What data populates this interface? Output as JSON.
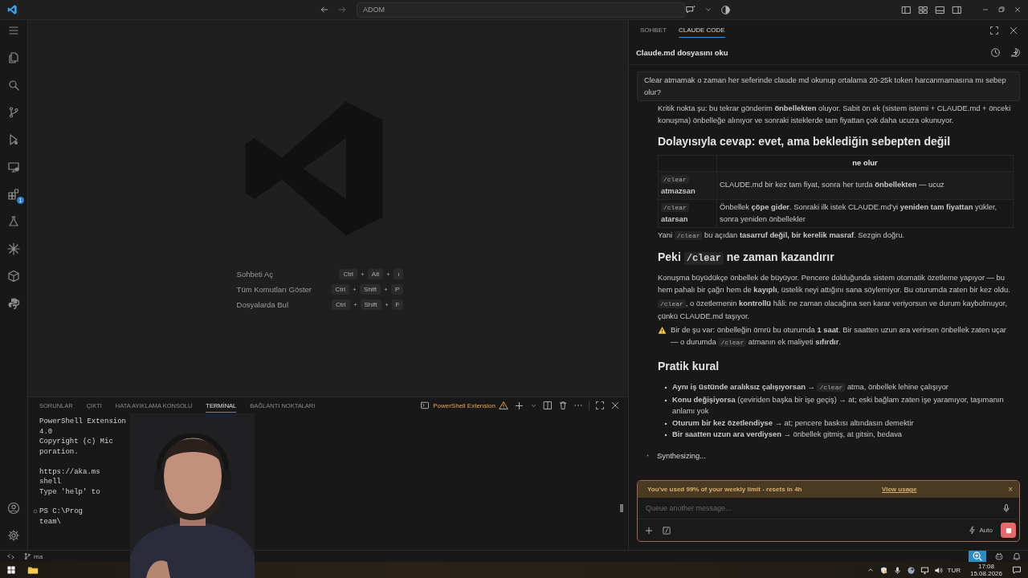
{
  "titlebar": {
    "search": "ADOM"
  },
  "activity_bar": {
    "extensions_badge": "1"
  },
  "shortcuts": [
    {
      "label": "Sohbeti Aç",
      "keys": [
        "Ctrl",
        "Alt",
        "ı"
      ]
    },
    {
      "label": "Tüm Komutları Göster",
      "keys": [
        "Ctrl",
        "Shift",
        "P"
      ]
    },
    {
      "label": "Dosyalarda Bul",
      "keys": [
        "Ctrl",
        "Shift",
        "F"
      ]
    }
  ],
  "panel": {
    "tabs": [
      {
        "label": "SORUNLAR",
        "selected": false
      },
      {
        "label": "ÇIKTI",
        "selected": false
      },
      {
        "label": "HATA AYIKLAMA KONSOLU",
        "selected": false
      },
      {
        "label": "TERMİNAL",
        "selected": true
      },
      {
        "label": "BAĞLANTI NOKTALARI",
        "selected": false
      }
    ],
    "terminal_name": "PowerShell Extension",
    "terminal_groups": [
      [
        "PowerShell Extension",
        "4.0",
        "Copyright (c) Mic",
        "poration."
      ],
      [
        "https://aka.ms",
        "shell",
        "Type 'help' to"
      ],
      [
        "PS C:\\Prog",
        "team\\"
      ]
    ]
  },
  "chat": {
    "tabs": [
      {
        "label": "SOHBET",
        "selected": false
      },
      {
        "label": "CLAUDE CODE",
        "selected": true
      }
    ],
    "title": "Claude.md dosyasını oku",
    "user_message": "Clear atmamak o zaman her seferinde claude md okunup ortalama 20-25k token harcanmamasına mı sebep olur?",
    "blocks": [
      {
        "kind": "paragraph",
        "segments": [
          {
            "kind": "text",
            "text": "Kritik nokta şu: bu tekrar gönderim **önbellekten** oluyor. Sabit ön ek (sistem istemi + CLAUDE.md + önceki konuşma) önbelleğe alınıyor ve sonraki isteklerde tam fiyattan çok daha ucuza okunuyor."
          }
        ]
      },
      {
        "kind": "heading",
        "segments": [
          {
            "kind": "text",
            "text": "Dolayısıyla cevap: evet, ama beklediğin sebepten değil"
          }
        ]
      },
      {
        "kind": "table",
        "header": "ne olur",
        "rows": [
          {
            "label": [
              {
                "kind": "code",
                "text": "/clear"
              },
              {
                "kind": "text",
                "text": " **atmazsan**"
              }
            ],
            "value": [
              {
                "kind": "text",
                "text": "CLAUDE.md bir kez tam fiyat, sonra her turda **önbellekten** — ucuz"
              }
            ]
          },
          {
            "label": [
              {
                "kind": "code",
                "text": "/clear"
              },
              {
                "kind": "text",
                "text": " **atarsan**"
              }
            ],
            "value": [
              {
                "kind": "text",
                "text": "Önbellek **çöpe gider**. Sonraki ilk istek CLAUDE.md'yi **yeniden tam fiyattan** yükler, sonra yeniden önbellekler"
              }
            ]
          }
        ]
      },
      {
        "kind": "paragraph",
        "segments": [
          {
            "kind": "text",
            "text": "Yani "
          },
          {
            "kind": "code",
            "text": "/clear"
          },
          {
            "kind": "text",
            "text": " bu açıdan **tasarruf değil, bir kerelik masraf**. Sezgin doğru."
          }
        ]
      },
      {
        "kind": "heading",
        "segments": [
          {
            "kind": "text",
            "text": "Peki "
          },
          {
            "kind": "code",
            "text": "/clear"
          },
          {
            "kind": "text",
            "text": " ne zaman kazandırır"
          }
        ]
      },
      {
        "kind": "paragraph",
        "segments": [
          {
            "kind": "text",
            "text": "Konuşma büyüdükçe önbellek de büyüyor. Pencere dolduğunda sistem otomatik özetleme yapıyor — bu hem pahalı bir çağrı hem de **kayıplı**, üstelik neyi attığını sana söylemiyor. Bu oturumda zaten bir kez oldu."
          }
        ]
      },
      {
        "kind": "paragraph",
        "segments": [
          {
            "kind": "code",
            "text": "/clear"
          },
          {
            "kind": "text",
            "text": ", o özetlemenin **kontrollü** hâli: ne zaman olacağına sen karar veriyorsun ve durum kaybolmuyor, çünkü CLAUDE.md taşıyor."
          }
        ]
      },
      {
        "kind": "warning",
        "segments": [
          {
            "kind": "text",
            "text": "Bir de şu var: önbelleğin ömrü bu oturumda **1 saat**. Bir saatten uzun ara verirsen önbellek zaten uçar — o durumda "
          },
          {
            "kind": "code",
            "text": "/clear"
          },
          {
            "kind": "text",
            "text": " atmanın ek maliyeti **sıfırdır**."
          }
        ]
      },
      {
        "kind": "heading",
        "segments": [
          {
            "kind": "text",
            "text": "Pratik kural"
          }
        ]
      },
      {
        "kind": "list",
        "items": [
          [
            {
              "kind": "text",
              "text": "**Aynı iş üstünde aralıksız çalışıyorsan** → "
            },
            {
              "kind": "code",
              "text": "/clear"
            },
            {
              "kind": "text",
              "text": " atma, önbellek lehine çalışıyor"
            }
          ],
          [
            {
              "kind": "text",
              "text": "**Konu değişiyorsa** (çeviriden başka bir işe geçiş) → at; eski bağlam zaten işe yaramıyor, taşımanın anlamı yok"
            }
          ],
          [
            {
              "kind": "text",
              "text": "**Oturum bir kez özetlendiyse** → at; pencere baskısı altındasın demektir"
            }
          ],
          [
            {
              "kind": "text",
              "text": "**Bir saatten uzun ara verdiysen** → önbellek gitmiş, at gitsin, bedava"
            }
          ]
        ]
      }
    ],
    "status": "Synthesizing...",
    "usage_banner": {
      "text": "You've used 99% of your weekly limit - resets in 4h",
      "link": "View usage",
      "close": "×"
    },
    "input": {
      "placeholder": "Queue another message..."
    },
    "mode": "Auto"
  },
  "status_bar": {
    "branch": "ma"
  },
  "taskbar": {
    "language": "TUR",
    "time": "17:08",
    "date": "15.08.2026"
  }
}
